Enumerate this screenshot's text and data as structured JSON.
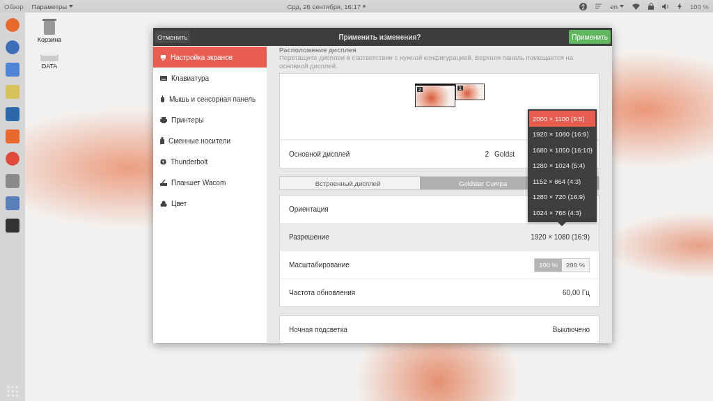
{
  "top_bar": {
    "activities": "Обзор",
    "app_menu": "Параметры",
    "clock": "Срд, 26 сентября, 16:17",
    "language": "en",
    "battery": "100 %"
  },
  "desktop_icons": [
    {
      "label": "Корзина",
      "kind": "trash"
    },
    {
      "label": "DATA",
      "kind": "drive"
    }
  ],
  "window": {
    "cancel": "Отменить",
    "title": "Применить изменения?",
    "apply": "Применить"
  },
  "sidebar": {
    "items": [
      {
        "label": "Настройка экранов",
        "kind": "display",
        "selected": true
      },
      {
        "label": "Клавиатура",
        "kind": "keyboard",
        "selected": false
      },
      {
        "label": "Мышь и сенсорная панель",
        "kind": "mouse",
        "selected": false
      },
      {
        "label": "Принтеры",
        "kind": "printer",
        "selected": false
      },
      {
        "label": "Сменные носители",
        "kind": "media",
        "selected": false
      },
      {
        "label": "Thunderbolt",
        "kind": "thunderbolt",
        "selected": false
      },
      {
        "label": "Планшет Wacom",
        "kind": "tablet",
        "selected": false
      },
      {
        "label": "Цвет",
        "kind": "color",
        "selected": false
      }
    ]
  },
  "arrangement": {
    "title": "Расположение дисплея",
    "description": "Перетащите дисплеи в соответствии с нужной конфигурацией. Верхняя панель помещается на основной дисплей.",
    "monitors": [
      {
        "number": "2",
        "primary": true
      },
      {
        "number": "1",
        "primary": false
      }
    ],
    "primary_row": {
      "label": "Основной дисплей",
      "number": "2",
      "name": "Goldst"
    }
  },
  "display_tabs": [
    {
      "label": "Встроенный дисплей",
      "selected": false
    },
    {
      "label": "Goldstar Compa",
      "selected": true
    }
  ],
  "settings": [
    {
      "kind": "value",
      "label": "Ориентация",
      "highlighted": false
    },
    {
      "kind": "value",
      "label": "Разрешение",
      "value": "1920 × 1080 (16:9)",
      "highlighted": true
    },
    {
      "kind": "toggle",
      "label": "Масштабирование",
      "highlighted": false,
      "options": [
        {
          "label": "100 %",
          "selected": true
        },
        {
          "label": "200 %",
          "selected": false
        }
      ]
    },
    {
      "kind": "value",
      "label": "Частота обновления",
      "value": "60,00 Гц",
      "highlighted": false
    }
  ],
  "night_light": {
    "label": "Ночная подсветка",
    "value": "Выключено"
  },
  "resolution_menu": [
    {
      "label": "2000 × 1100 (9:5)",
      "selected": true
    },
    {
      "label": "1920 × 1080 (16:9)",
      "selected": false
    },
    {
      "label": "1680 × 1050 (16:10)",
      "selected": false
    },
    {
      "label": "1280 × 1024 (5:4)",
      "selected": false
    },
    {
      "label": "1152 × 864 (4:3)",
      "selected": false
    },
    {
      "label": "1280 × 720 (16:9)",
      "selected": false
    },
    {
      "label": "1024 × 768 (4:3)",
      "selected": false
    }
  ]
}
